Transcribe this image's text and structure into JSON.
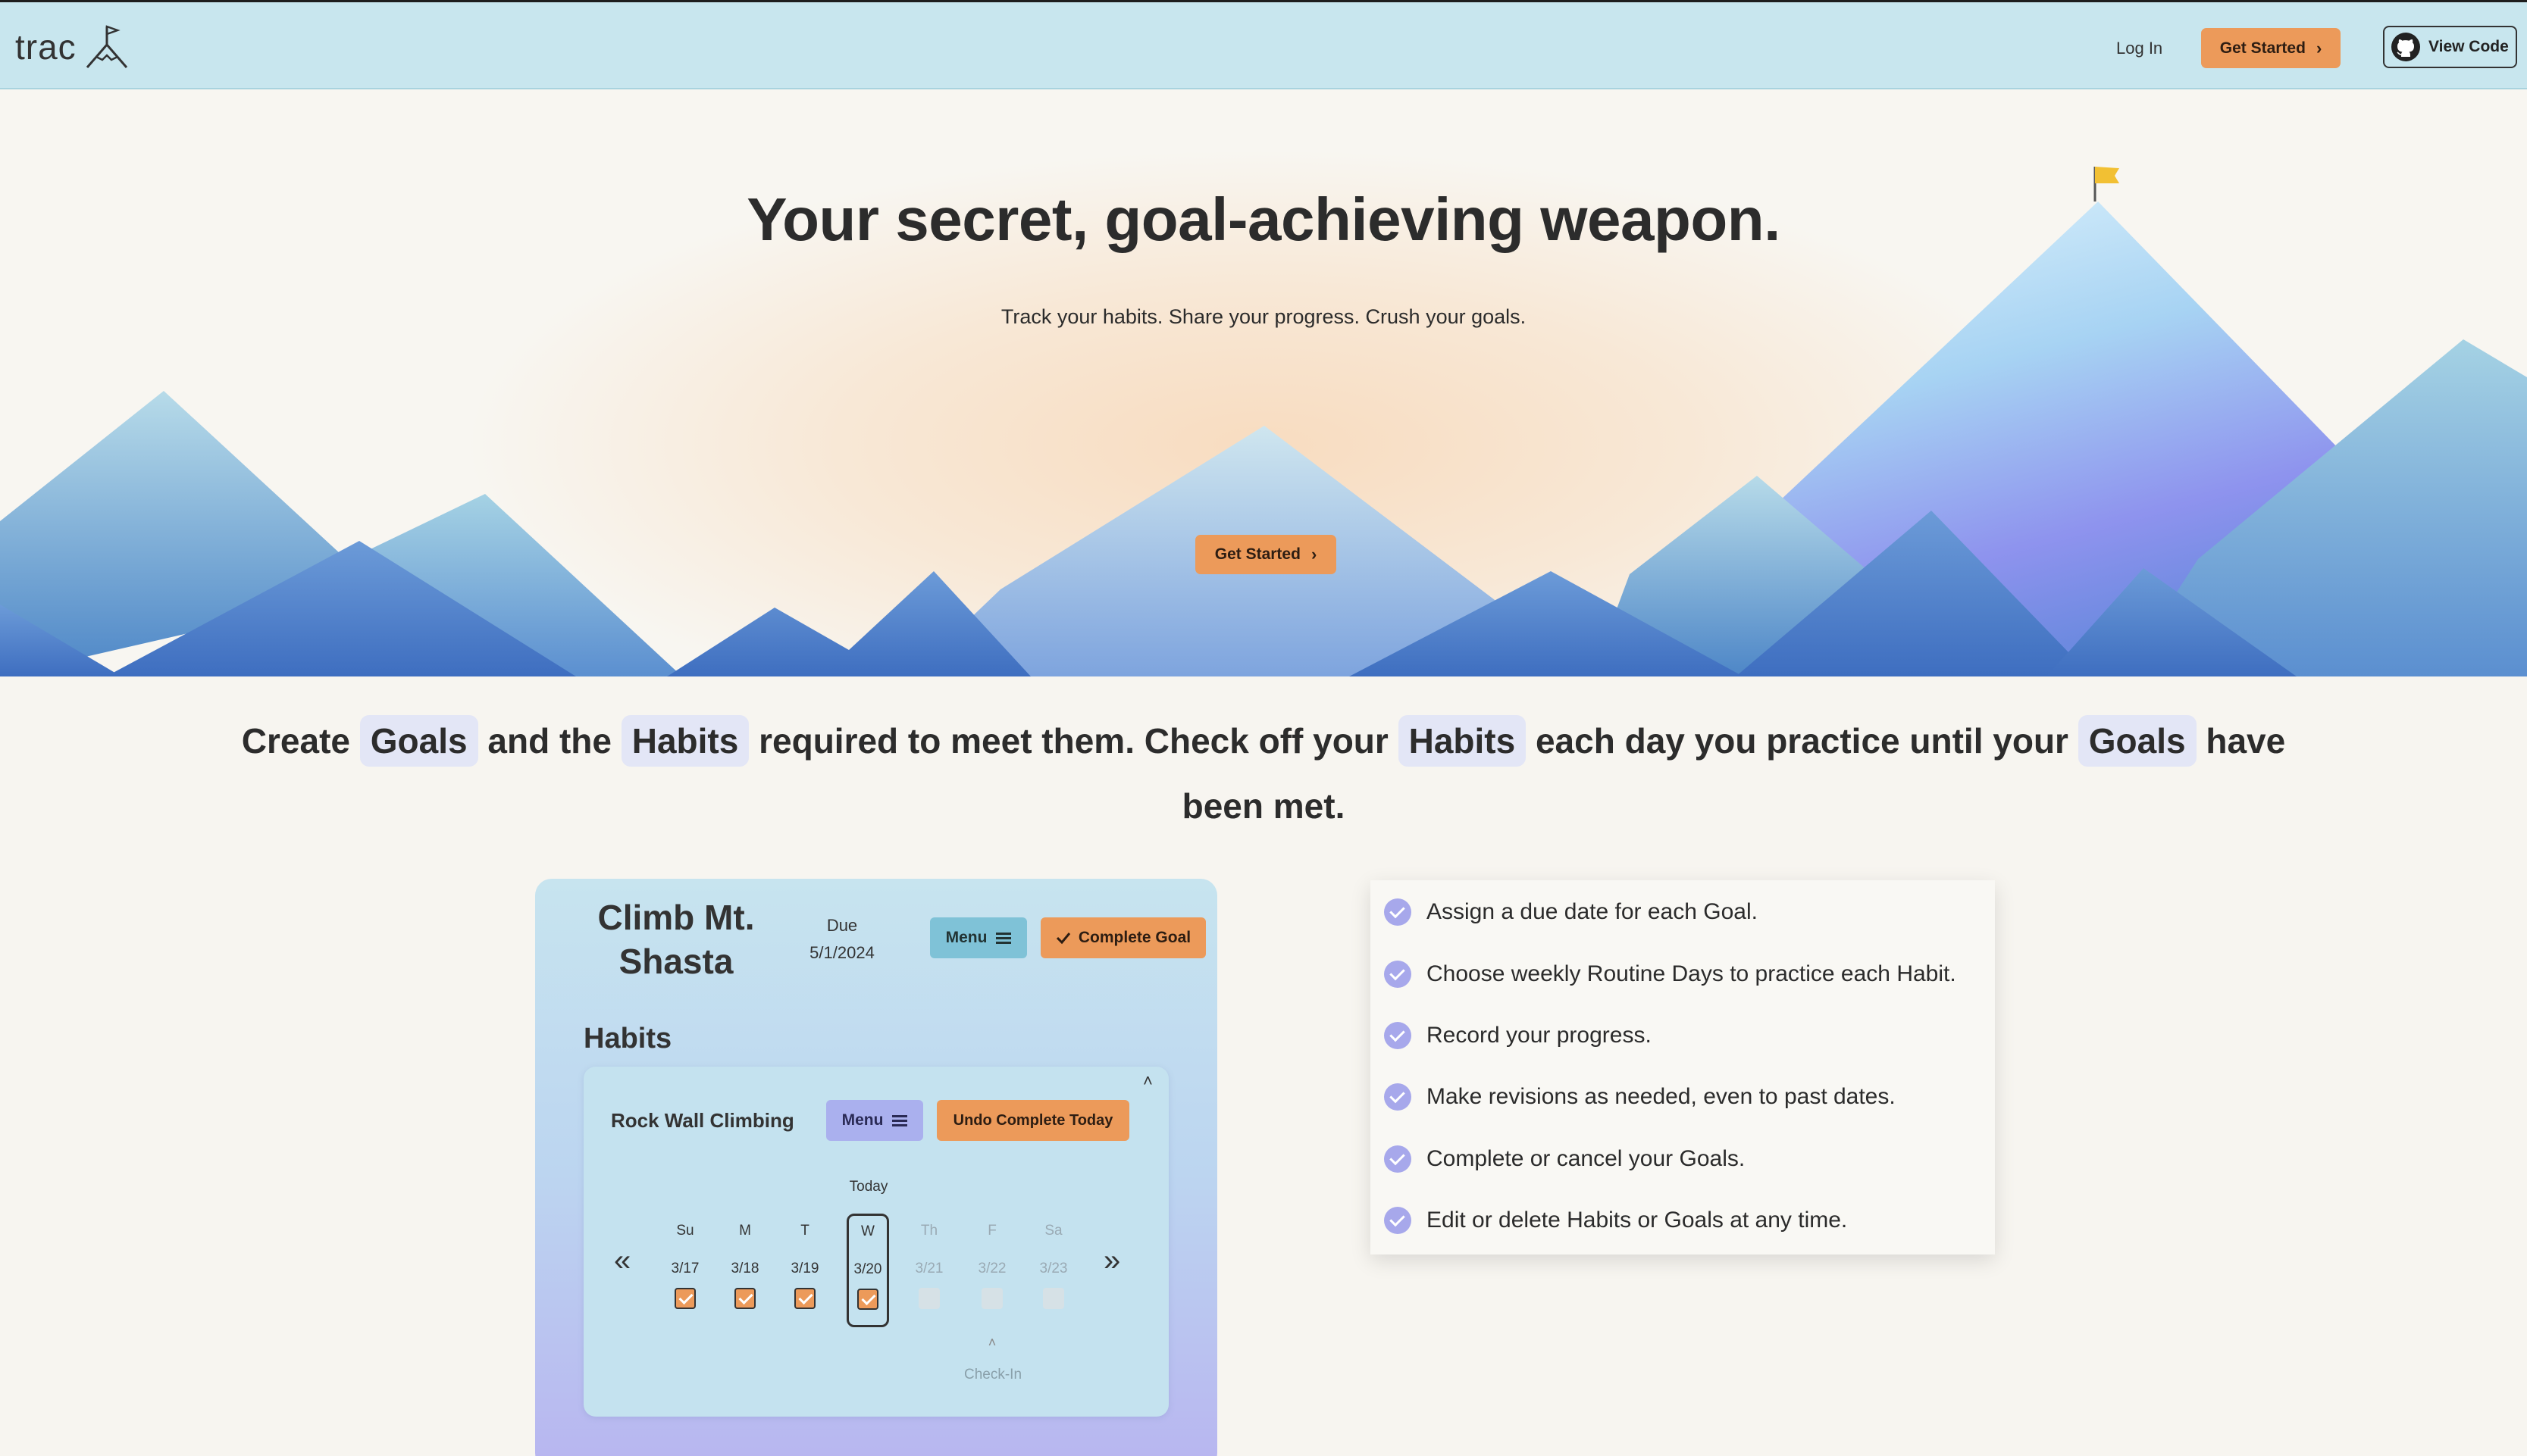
{
  "nav": {
    "logo_text": "trac",
    "login_label": "Log In",
    "cta_label": "Get Started",
    "view_code_label": "View Code"
  },
  "hero": {
    "title": "Your secret, goal-achieving weapon.",
    "subtitle": "Track your habits. Share your progress. Crush your goals.",
    "cta_label": "Get Started"
  },
  "tagline": {
    "parts": [
      "Create",
      "Goals",
      "and the",
      "Habits",
      "required to meet them. Check off your",
      "Habits",
      "each day you practice until your",
      "Goals",
      "have been met."
    ]
  },
  "goal_card": {
    "title": "Climb Mt. Shasta",
    "due_label": "Due",
    "due_date": "5/1/2024",
    "menu_label": "Menu",
    "complete_label": "Complete Goal",
    "habits_heading": "Habits",
    "habit": {
      "name": "Rock Wall Climbing",
      "menu_label": "Menu",
      "undo_label": "Undo Complete Today",
      "today_label": "Today",
      "checkin_label": "Check-In",
      "prev_label": "«",
      "next_label": "»",
      "days": [
        {
          "letter": "Su",
          "date": "3/17",
          "checked": true
        },
        {
          "letter": "M",
          "date": "3/18",
          "checked": true
        },
        {
          "letter": "T",
          "date": "3/19",
          "checked": true
        },
        {
          "letter": "W",
          "date": "3/20",
          "checked": true
        },
        {
          "letter": "Th",
          "date": "3/21",
          "checked": false
        },
        {
          "letter": "F",
          "date": "3/22",
          "checked": false
        },
        {
          "letter": "Sa",
          "date": "3/23",
          "checked": false
        }
      ]
    }
  },
  "features": [
    "Assign a due date for each Goal.",
    "Choose weekly Routine Days to practice each Habit.",
    "Record your progress.",
    "Make revisions as needed, even to past dates.",
    "Complete or cancel your Goals.",
    "Edit or delete Habits or Goals at any time."
  ],
  "colors": {
    "nav_bg": "#c8e6ee",
    "accent_orange": "#ec9a5a",
    "menu_teal": "#7fc2d7",
    "menu_purple": "#aab0ee",
    "check_purple": "#a7a8eb",
    "pill_bg": "#e3e6f6",
    "page_bg": "#f7f5f0"
  },
  "icons": [
    "flag-mountain-logo-icon",
    "chevron-right-icon",
    "github-icon",
    "hamburger-icon",
    "check-icon",
    "chevron-up-icon",
    "double-chevron-left-icon",
    "double-chevron-right-icon",
    "flag-icon"
  ]
}
